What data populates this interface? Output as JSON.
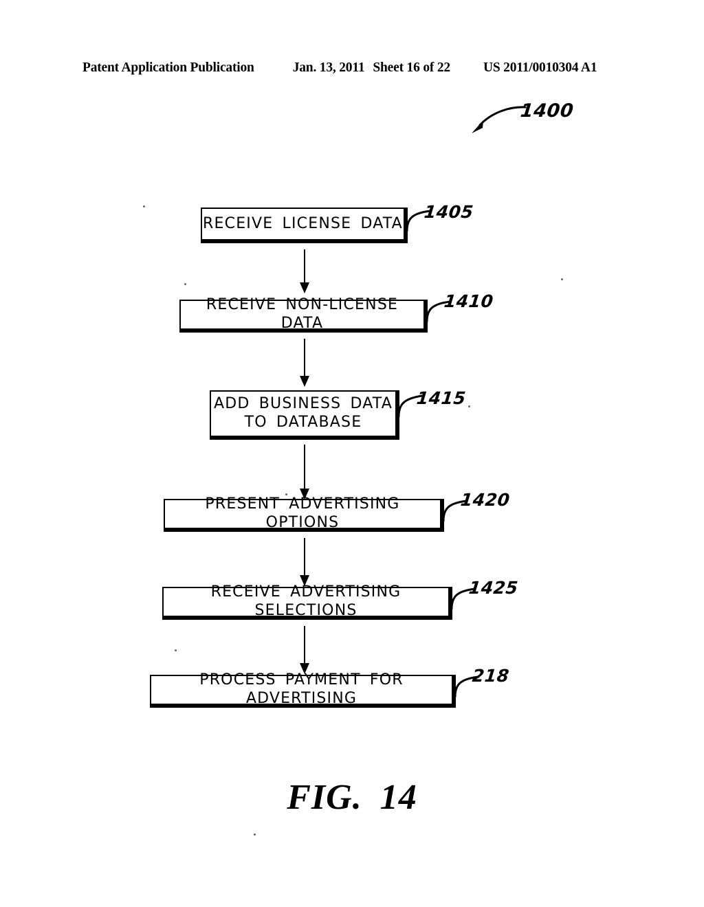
{
  "header": {
    "publication": "Patent Application Publication",
    "date": "Jan. 13, 2011",
    "sheet": "Sheet 16 of 22",
    "doc_number": "US 2011/0010304 A1"
  },
  "figure": {
    "diagram_ref": "1400",
    "caption_word": "FIG.",
    "caption_number": "14",
    "steps": [
      {
        "ref": "1405",
        "label": "RECEIVE LICENSE DATA"
      },
      {
        "ref": "1410",
        "label": "RECEIVE NON-LICENSE DATA"
      },
      {
        "ref": "1415",
        "label": "ADD BUSINESS DATA\nTO DATABASE"
      },
      {
        "ref": "1420",
        "label": "PRESENT ADVERTISING OPTIONS"
      },
      {
        "ref": "1425",
        "label": "RECEIVE ADVERTISING SELECTIONS"
      },
      {
        "ref": "218",
        "label": "PROCESS PAYMENT FOR ADVERTISING"
      }
    ]
  },
  "colors": {
    "ink": "#000000",
    "paper": "#ffffff"
  }
}
